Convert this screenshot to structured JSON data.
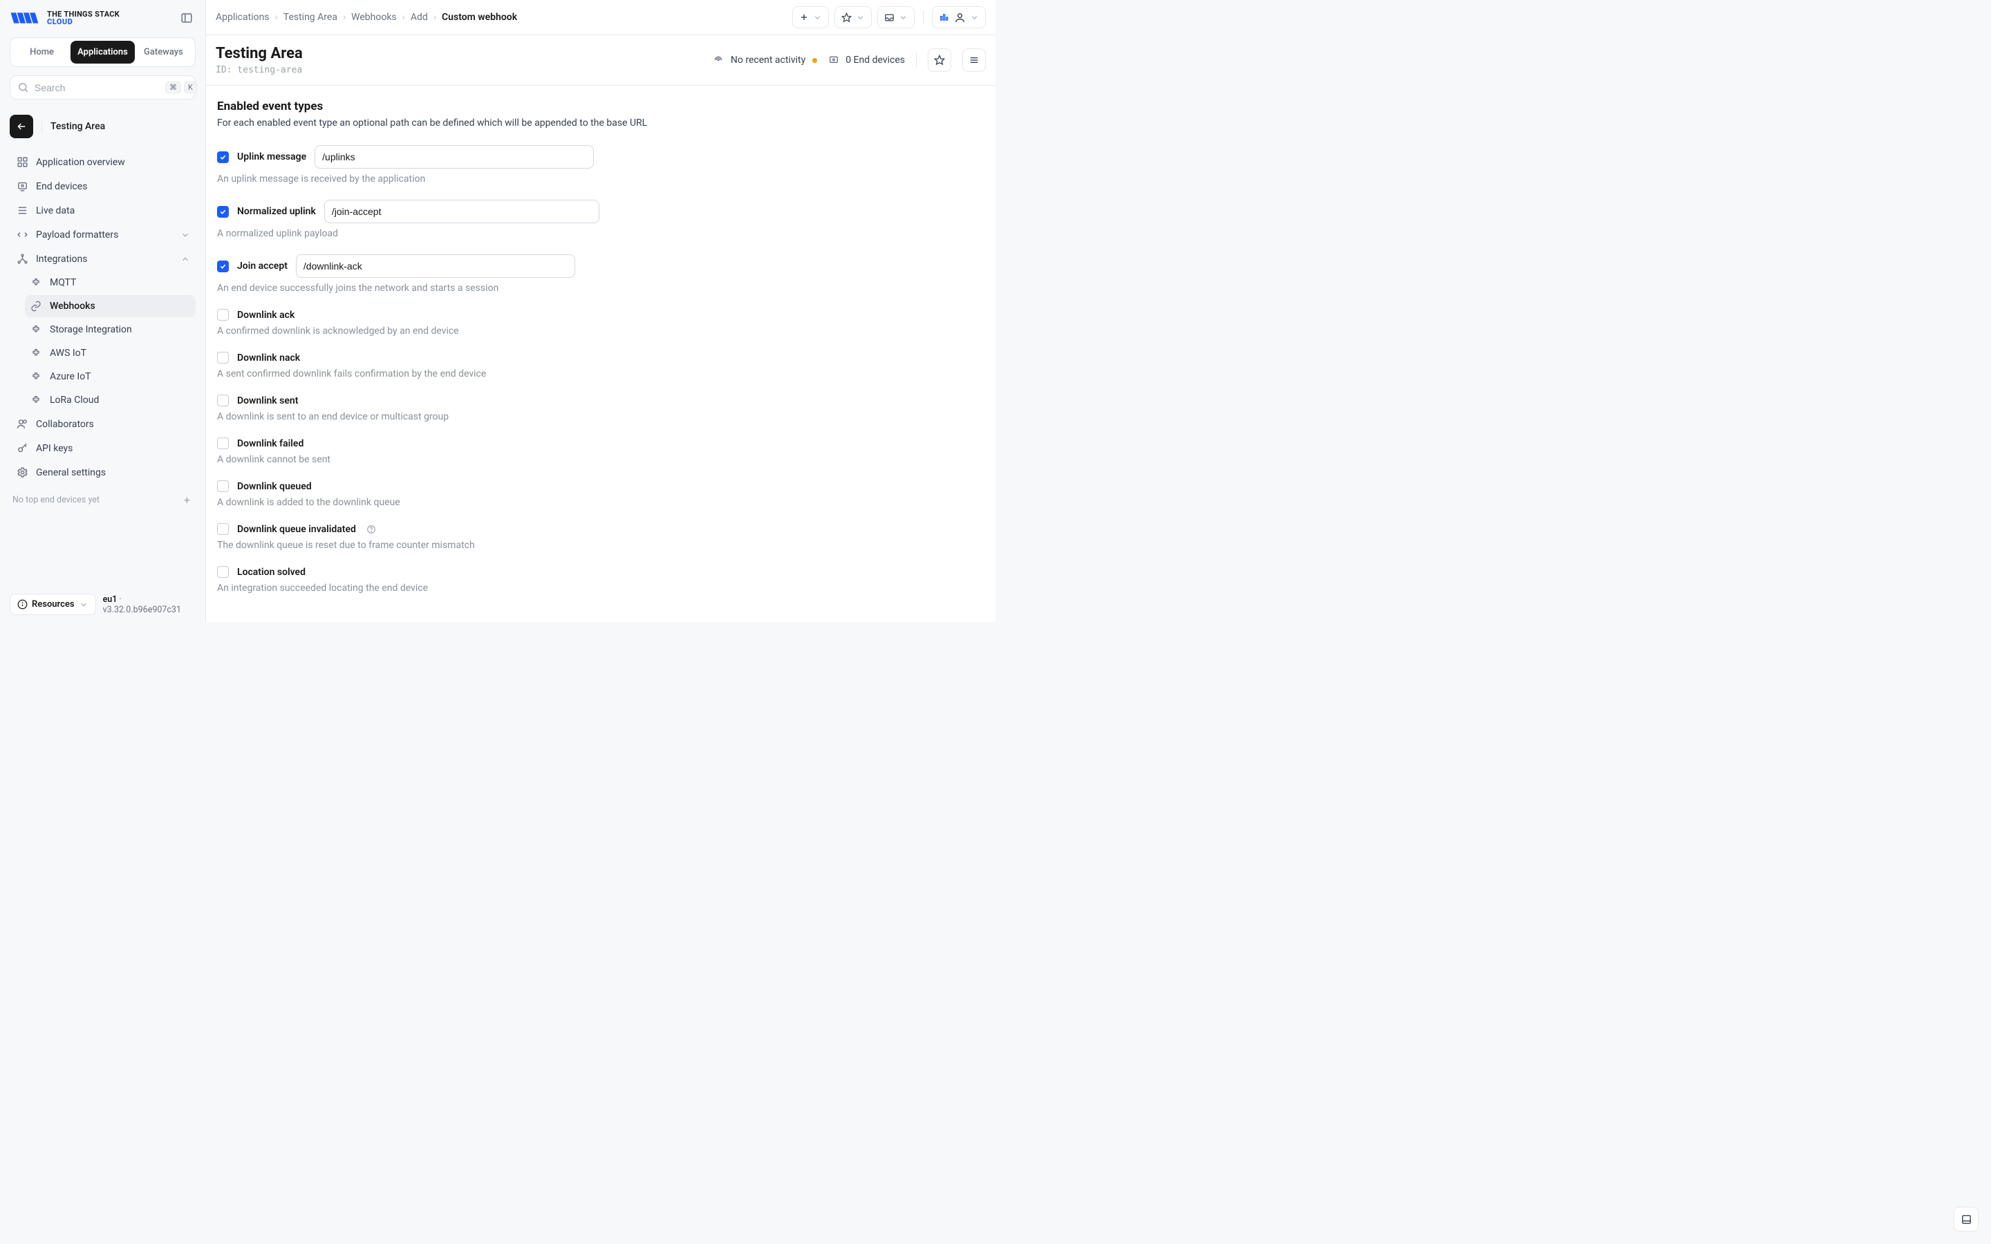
{
  "brand": {
    "line1": "THE THINGS STACK",
    "line2": "CLOUD"
  },
  "nav_tabs": {
    "home": "Home",
    "applications": "Applications",
    "gateways": "Gateways"
  },
  "search": {
    "placeholder": "Search",
    "kbd1": "⌘",
    "kbd2": "K"
  },
  "context": {
    "title": "Testing Area"
  },
  "sidenav": {
    "overview": "Application overview",
    "end_devices": "End devices",
    "live_data": "Live data",
    "payload": "Payload formatters",
    "integrations": "Integrations",
    "mqtt": "MQTT",
    "webhooks": "Webhooks",
    "storage": "Storage Integration",
    "aws": "AWS IoT",
    "azure": "Azure IoT",
    "lora": "LoRa Cloud",
    "collaborators": "Collaborators",
    "api_keys": "API keys",
    "general": "General settings",
    "top_end_devices": "No top end devices yet"
  },
  "footer": {
    "resources": "Resources",
    "cluster": "eu1",
    "version": "v3.32.0.b96e907c31"
  },
  "breadcrumbs": [
    "Applications",
    "Testing Area",
    "Webhooks",
    "Add",
    "Custom webhook"
  ],
  "page": {
    "title": "Testing Area",
    "id_label": "ID: testing-area",
    "activity": "No recent activity",
    "devices": "0 End devices"
  },
  "section": {
    "title": "Enabled event types",
    "desc": "For each enabled event type an optional path can be defined which will be appended to the base URL"
  },
  "events": [
    {
      "label": "Uplink message",
      "checked": true,
      "value": "/uplinks",
      "desc": "An uplink message is received by the application",
      "w": "w1"
    },
    {
      "label": "Normalized uplink",
      "checked": true,
      "value": "/join-accept",
      "desc": "A normalized uplink payload",
      "w": "w2"
    },
    {
      "label": "Join accept",
      "checked": true,
      "value": "/downlink-ack",
      "desc": "An end device successfully joins the network and starts a session",
      "w": "w3"
    },
    {
      "label": "Downlink ack",
      "checked": false,
      "desc": "A confirmed downlink is acknowledged by an end device"
    },
    {
      "label": "Downlink nack",
      "checked": false,
      "desc": "A sent confirmed downlink fails confirmation by the end device"
    },
    {
      "label": "Downlink sent",
      "checked": false,
      "desc": "A downlink is sent to an end device or multicast group"
    },
    {
      "label": "Downlink failed",
      "checked": false,
      "desc": "A downlink cannot be sent"
    },
    {
      "label": "Downlink queued",
      "checked": false,
      "desc": "A downlink is added to the downlink queue"
    },
    {
      "label": "Downlink queue invalidated",
      "checked": false,
      "help": true,
      "desc": "The downlink queue is reset due to frame counter mismatch"
    },
    {
      "label": "Location solved",
      "checked": false,
      "desc": "An integration succeeded locating the end device"
    }
  ]
}
